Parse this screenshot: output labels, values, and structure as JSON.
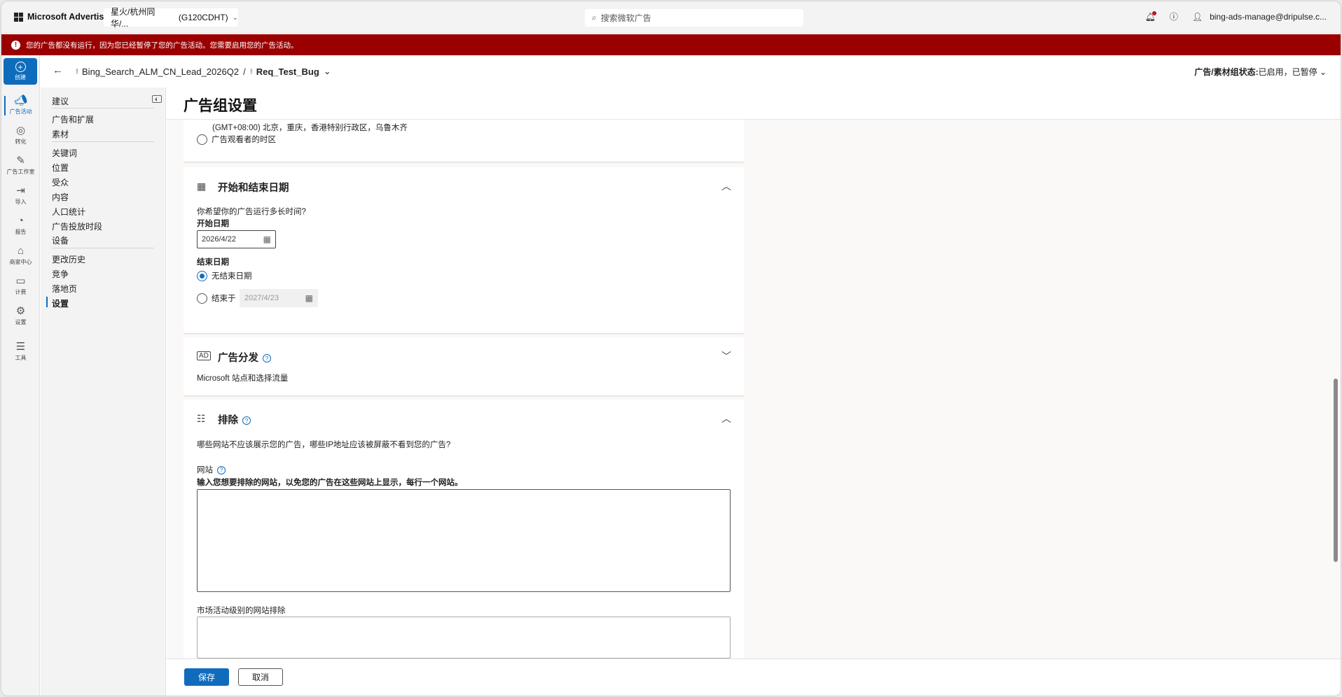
{
  "topbar": {
    "brand": "Microsoft Advertising",
    "account": "星火/杭州同华/...",
    "account_id": "(G120CDHT)",
    "search_placeholder": "搜索微软广告",
    "user": "bing-ads-manage@dripulse.c..."
  },
  "alert": {
    "text": "您的广告都没有运行，因为您已经暂停了您的广告活动。您需要启用您的广告活动。"
  },
  "rail": {
    "create": "创建",
    "items": [
      "广告活动",
      "转化",
      "广告工作室",
      "导入",
      "报告",
      "商家中心",
      "计费",
      "设置",
      "工具"
    ]
  },
  "breadcrumb": {
    "campaign": "Bing_Search_ALM_CN_Lead_2026Q2",
    "separator": "/",
    "adgroup": "Req_Test_Bug",
    "status_label": "广告/素材组状态:",
    "status_value": "已启用，已暂停"
  },
  "nav": {
    "items": [
      "建议",
      "广告和扩展",
      "素材",
      "关键词",
      "位置",
      "受众",
      "内容",
      "人口统计",
      "广告投放时段",
      "设备",
      "更改历史",
      "竞争",
      "落地页",
      "设置"
    ]
  },
  "page": {
    "title": "广告组设置"
  },
  "timezone": {
    "option_text": "(GMT+08:00) 北京，重庆，香港特别行政区，乌鲁木齐",
    "viewer_timezone": "广告观看者的时区"
  },
  "dates": {
    "title": "开始和结束日期",
    "question": "你希望你的广告运行多长时间?",
    "start_label": "开始日期",
    "start_value": "2026/4/22",
    "end_label": "结束日期",
    "no_end": "无结束日期",
    "end_on": "结束于",
    "end_value": "2027/4/23"
  },
  "distribution": {
    "title": "广告分发",
    "desc": "Microsoft 站点和选择流量"
  },
  "exclusions": {
    "title": "排除",
    "question": "哪些网站不应该展示您的广告，哪些IP地址应该被屏蔽不看到您的广告?",
    "website_label": "网站",
    "website_hint": "输入您想要排除的网站，以免您的广告在这些网站上显示，每行一个网站。",
    "campaign_level": "市场活动级别的网站排除"
  },
  "footer": {
    "save": "保存",
    "cancel": "取消"
  }
}
